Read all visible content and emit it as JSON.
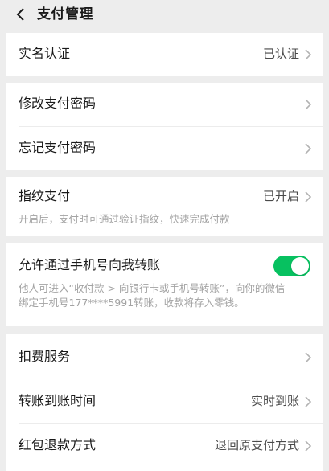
{
  "header": {
    "title": "支付管理"
  },
  "real_name": {
    "label": "实名认证",
    "value": "已认证"
  },
  "password": {
    "modify_label": "修改支付密码",
    "forgot_label": "忘记支付密码"
  },
  "fingerprint": {
    "label": "指纹支付",
    "value": "已开启",
    "desc": "开启后，支付时可通过验证指纹，快速完成付款"
  },
  "phone_transfer": {
    "label": "允许通过手机号向我转账",
    "enabled": true,
    "desc_line1": "他人可进入“收付款 > 向银行卡或手机号转账”，向你的微信",
    "desc_line2": "绑定手机号177****5991转账，收款将存入零钱。"
  },
  "services": {
    "deduct_label": "扣费服务",
    "arrival_label": "转账到账时间",
    "arrival_value": "实时到账",
    "refund_label": "红包退款方式",
    "refund_value": "退回原支付方式"
  },
  "colors": {
    "toggle_on": "#07c160",
    "background": "#ededed"
  }
}
